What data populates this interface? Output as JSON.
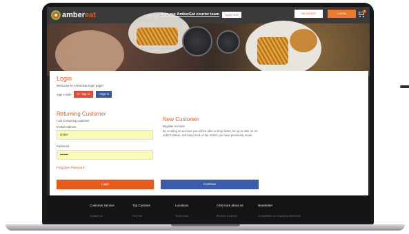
{
  "brand": {
    "name_part1": "amber",
    "name_part2": "eat"
  },
  "header": {
    "courier_text": "Join our AmberEat courier team",
    "apply_label": "Apply Here",
    "register_label": "REGISTER",
    "login_label": "LOGIN",
    "cart_count": "0"
  },
  "login": {
    "title": "Login",
    "welcome": "Welcome to AmberEat login page!",
    "signin_label": "Sign in with",
    "google_label": "G+ Sign in",
    "facebook_label": "f  Sign in"
  },
  "returning": {
    "title": "Returning Customer",
    "subtitle": "I am a returning customer",
    "email_label": "E-Mail Address",
    "email_value": "amber",
    "password_label": "Password",
    "password_value": "••••••••",
    "forgot_label": "Forgotten Password",
    "login_button": "Login"
  },
  "new_customer": {
    "title": "New Customer",
    "subtitle": "Register Account",
    "description": "By creating an account you will be able to shop faster, be up to date on an order's status, and keep track of the orders you have previously made.",
    "continue_button": "Continue"
  },
  "footer": {
    "columns": [
      {
        "title": "Customer Service",
        "sub": "Contact Us"
      },
      {
        "title": "Top Cuisines",
        "sub": "Red Hot"
      },
      {
        "title": "Locations",
        "sub": "Show more"
      },
      {
        "title": "A bit more about us",
        "sub": "Become a partner"
      },
      {
        "title": "Newsletter",
        "sub": "A newsletter is a regularly distributed"
      }
    ]
  },
  "colors": {
    "accent": "#e85a1c",
    "facebook": "#3b5998",
    "google": "#dd4b39",
    "continue": "#3b5cad"
  }
}
